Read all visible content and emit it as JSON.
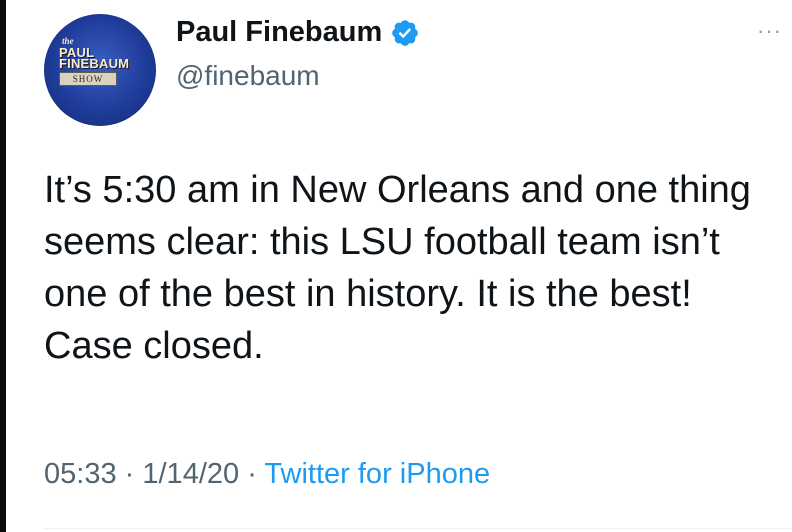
{
  "author": {
    "display_name": "Paul Finebaum",
    "handle": "@finebaum",
    "verified": true,
    "avatar": {
      "the": "the",
      "line1": "PAUL",
      "line2": "FINEBAUM",
      "line3": "SHOW"
    }
  },
  "tweet": {
    "text": "It’s 5:30 am in New Orleans and one thing seems clear: this LSU football team isn’t one of the best in history. It is the best! Case closed.",
    "time": "05:33",
    "date": "1/14/20",
    "separator": "·",
    "source": "Twitter for iPhone"
  },
  "menu": {
    "more_label": "···"
  },
  "colors": {
    "verified_blue": "#1d9bf0",
    "source_blue": "#1d9bf0",
    "muted_gray": "#536471"
  }
}
